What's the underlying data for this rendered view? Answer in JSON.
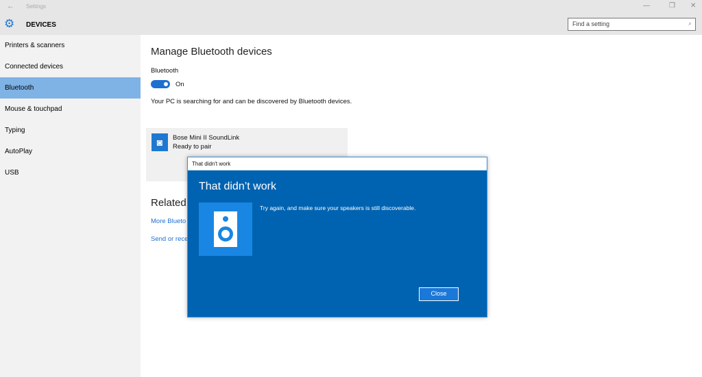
{
  "window": {
    "title": "Settings",
    "back": "←",
    "minimize": "—",
    "restore": "❐",
    "close": "✕"
  },
  "header": {
    "title": "DEVICES",
    "search_placeholder": "Find a setting"
  },
  "sidebar": {
    "items": [
      {
        "label": "Printers & scanners"
      },
      {
        "label": "Connected devices"
      },
      {
        "label": "Bluetooth",
        "selected": true
      },
      {
        "label": "Mouse & touchpad"
      },
      {
        "label": "Typing"
      },
      {
        "label": "AutoPlay"
      },
      {
        "label": "USB"
      }
    ]
  },
  "main": {
    "title": "Manage Bluetooth devices",
    "bt_label": "Bluetooth",
    "bt_state": "On",
    "status": "Your PC is searching for and can be discovered by Bluetooth devices.",
    "device": {
      "name": "Bose Mini II SoundLink",
      "status": "Ready to pair"
    },
    "related": "Related",
    "links": [
      "More Blueto",
      "Send or rece"
    ]
  },
  "dialog": {
    "titlebar": "That didn't work",
    "heading": "That didn’t work",
    "message": "Try again, and make sure your speakers is still discoverable.",
    "close": "Close"
  },
  "colors": {
    "accent": "#0063b1",
    "selected": "#7fb2e5"
  }
}
